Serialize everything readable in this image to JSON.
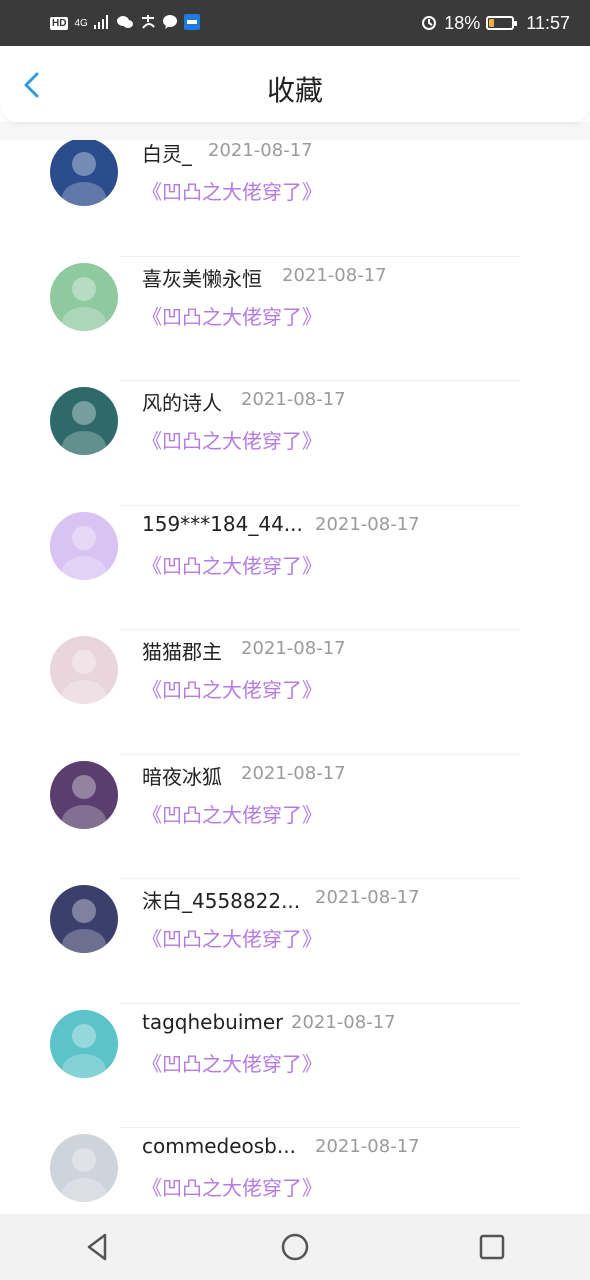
{
  "status_bar": {
    "hd": "HD",
    "signal": "4G",
    "battery": "18%",
    "time": "11:57",
    "icons": [
      "wechat-icon",
      "alipay-icon",
      "message-icon",
      "app-icon",
      "alarm-icon",
      "battery-icon"
    ]
  },
  "header": {
    "title": "收藏",
    "back_icon": "chevron-left-icon"
  },
  "items": [
    {
      "name": "白灵_",
      "date": "2021-08-17",
      "book": "《凹凸之大佬穿了》",
      "avatar_color": "#2b4d8e"
    },
    {
      "name": "喜灰美懒永恒",
      "date": "2021-08-17",
      "book": "《凹凸之大佬穿了》",
      "avatar_color": "#8fc9a0"
    },
    {
      "name": "风的诗人",
      "date": "2021-08-17",
      "book": "《凹凸之大佬穿了》",
      "avatar_color": "#2f6a6a"
    },
    {
      "name": "159***184_44...",
      "date": "2021-08-17",
      "book": "《凹凸之大佬穿了》",
      "avatar_color": "#d9c3f2"
    },
    {
      "name": "猫猫郡主",
      "date": "2021-08-17",
      "book": "《凹凸之大佬穿了》",
      "avatar_color": "#e8d6dc"
    },
    {
      "name": "暗夜冰狐",
      "date": "2021-08-17",
      "book": "《凹凸之大佬穿了》",
      "avatar_color": "#5a3f6e"
    },
    {
      "name": "沫白_4558822...",
      "date": "2021-08-17",
      "book": "《凹凸之大佬穿了》",
      "avatar_color": "#3b3f6b"
    },
    {
      "name": "tagqhebuimer",
      "date": "2021-08-17",
      "book": "《凹凸之大佬穿了》",
      "avatar_color": "#5cc3c8"
    },
    {
      "name": "commedeosb...",
      "date": "2021-08-17",
      "book": "《凹凸之大佬穿了》",
      "avatar_color": "#cfd3db"
    }
  ],
  "nav": {
    "back": "triangle-back-icon",
    "home": "circle-home-icon",
    "recent": "square-recent-icon"
  },
  "colors": {
    "book_title": "#b57be2",
    "accent": "#2f9be0",
    "date": "#9a9a9a"
  }
}
